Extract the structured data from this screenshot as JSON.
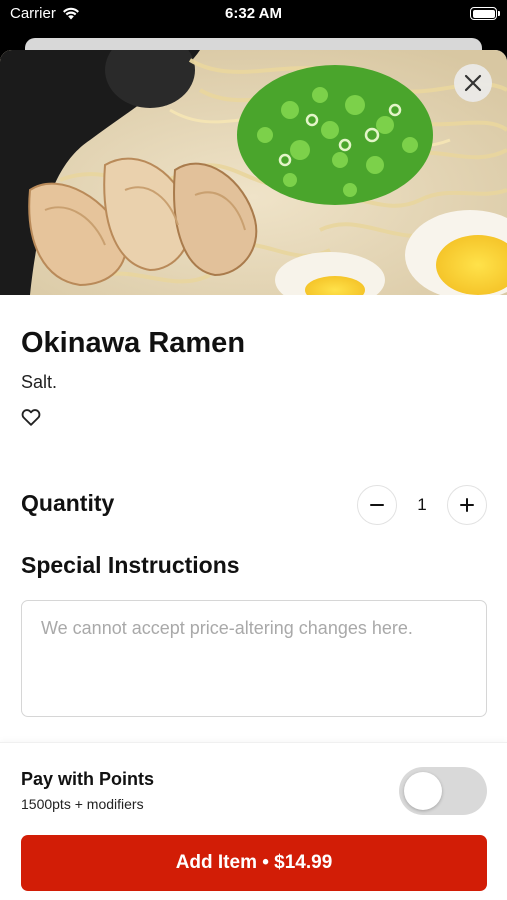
{
  "status_bar": {
    "carrier": "Carrier",
    "time": "6:32 AM"
  },
  "item": {
    "name": "Okinawa Ramen",
    "description": "Salt."
  },
  "quantity": {
    "label": "Quantity",
    "value": "1",
    "decrement_symbol": "−",
    "increment_symbol": "+"
  },
  "special_instructions": {
    "label": "Special Instructions",
    "placeholder": "We cannot accept price-altering changes here.",
    "value": ""
  },
  "points": {
    "label": "Pay with Points",
    "detail": "1500pts + modifiers",
    "enabled": false
  },
  "add_button": {
    "label": "Add Item • $14.99"
  },
  "icons": {
    "close": "close-icon",
    "favorite": "heart-outline-icon",
    "wifi": "wifi-icon",
    "battery": "battery-icon"
  },
  "colors": {
    "accent": "#d21d06",
    "toggle_off": "#d9d9d9"
  }
}
